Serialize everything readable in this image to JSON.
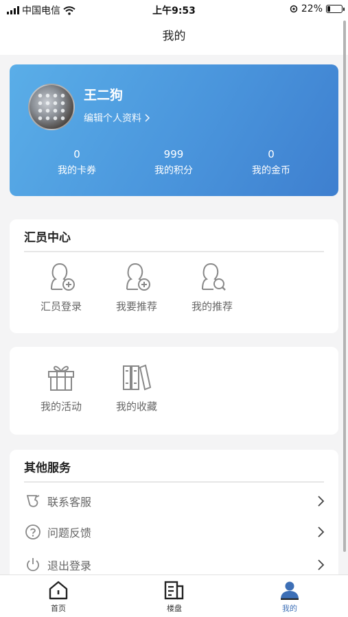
{
  "status_bar": {
    "carrier": "中国电信",
    "time": "上午9:53",
    "battery": "22%",
    "battery_level": 0.22
  },
  "header": {
    "title": "我的"
  },
  "profile": {
    "name": "王二狗",
    "edit_label": "编辑个人资料",
    "stats": [
      {
        "value": "0",
        "label": "我的卡券"
      },
      {
        "value": "999",
        "label": "我的积分"
      },
      {
        "value": "0",
        "label": "我的金币"
      }
    ]
  },
  "member_center": {
    "title": "汇员中心",
    "items": [
      {
        "label": "汇员登录",
        "icon": "user-add-icon"
      },
      {
        "label": "我要推荐",
        "icon": "user-add-icon"
      },
      {
        "label": "我的推荐",
        "icon": "user-search-icon"
      }
    ]
  },
  "activity": {
    "items": [
      {
        "label": "我的活动",
        "icon": "gift-icon"
      },
      {
        "label": "我的收藏",
        "icon": "books-icon"
      }
    ]
  },
  "other_services": {
    "title": "其他服务",
    "items": [
      {
        "label": "联系客服",
        "icon": "customer-service-icon"
      },
      {
        "label": "问题反馈",
        "icon": "question-icon"
      },
      {
        "label": "退出登录",
        "icon": "power-icon"
      }
    ]
  },
  "tab_bar": {
    "tabs": [
      {
        "label": "首页",
        "icon": "home-icon"
      },
      {
        "label": "楼盘",
        "icon": "building-list-icon"
      },
      {
        "label": "我的",
        "icon": "user-icon",
        "active": true
      }
    ]
  },
  "colors": {
    "accent": "#3d6fb6",
    "card_gradient_start": "#5aaee8",
    "card_gradient_end": "#3e7fcf"
  }
}
